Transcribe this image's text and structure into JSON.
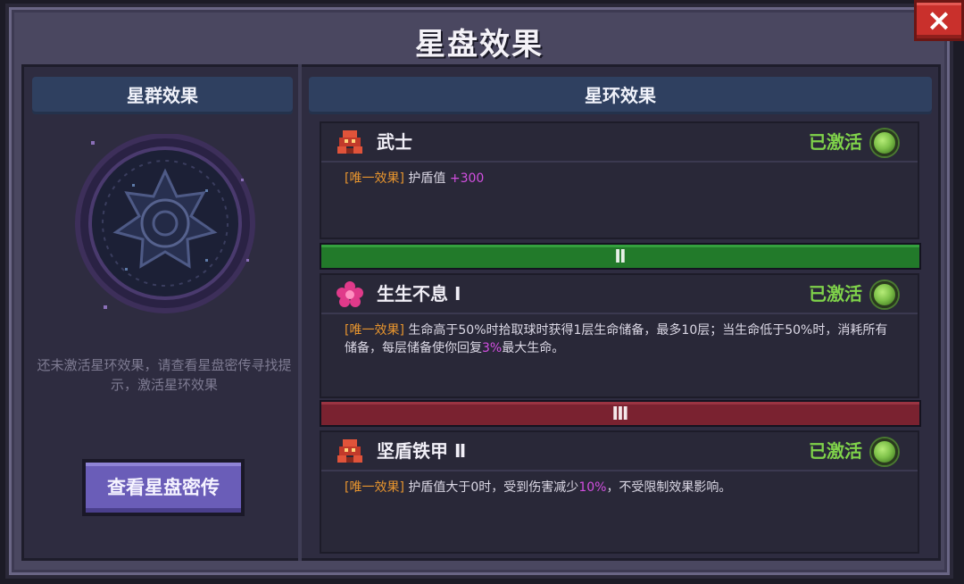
{
  "window": {
    "title": "星盘效果",
    "close_icon": "×"
  },
  "left_panel": {
    "header": "星群效果",
    "hint": "还未激活星环效果，请查看星盘密传寻找提示，激活星环效果",
    "button_label": "查看星盘密传"
  },
  "right_panel": {
    "header": "星环效果",
    "cards": [
      {
        "icon": "warrior-icon",
        "name": "武士",
        "status": "已激活",
        "tag": "[唯一效果]",
        "desc_parts": [
          "护盾值",
          "+300",
          ""
        ]
      },
      {
        "icon": "flower-icon",
        "name": "生生不息 Ⅰ",
        "status": "已激活",
        "tag": "[唯一效果]",
        "desc_parts": [
          "生命高于50%时拾取球时获得1层生命储备，最多10层；当生命低于50%时，消耗所有储备，每层储备使你回复",
          "3%",
          "最大生命。"
        ]
      },
      {
        "icon": "armor-icon",
        "name": "坚盾铁甲 Ⅱ",
        "status": "已激活",
        "tag": "[唯一效果]",
        "desc_parts": [
          "护盾值大于0时，受到伤害减少",
          "10%",
          "，不受限制效果影响。"
        ]
      }
    ],
    "tiers": [
      {
        "label": "Ⅱ",
        "color": "#227a2a"
      },
      {
        "label": "Ⅲ",
        "color": "#7a2230"
      }
    ]
  },
  "colors": {
    "active": "#7fd24a",
    "tag": "#e8952e",
    "highlight": "#d24fe0"
  }
}
